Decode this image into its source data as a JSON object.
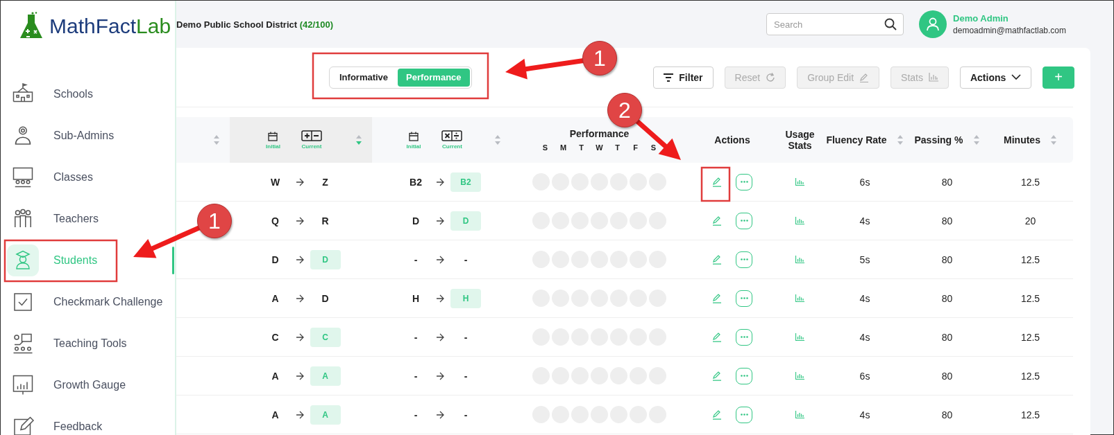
{
  "sidebar": {
    "logo": {
      "part1": "MathFact",
      "part2": "Lab"
    },
    "items": [
      {
        "label": "Schools",
        "selected": false
      },
      {
        "label": "Sub-Admins",
        "selected": false
      },
      {
        "label": "Classes",
        "selected": false
      },
      {
        "label": "Teachers",
        "selected": false
      },
      {
        "label": "Students",
        "selected": true
      },
      {
        "label": "Checkmark Challenge",
        "selected": false
      },
      {
        "label": "Teaching Tools",
        "selected": false
      },
      {
        "label": "Growth Gauge",
        "selected": false
      },
      {
        "label": "Feedback",
        "selected": false
      }
    ]
  },
  "header": {
    "district": "Demo Public School District",
    "quota": "(42/100)",
    "search": {
      "placeholder": "Search"
    },
    "user": {
      "name": "Demo Admin",
      "email": "demoadmin@mathfactlab.com"
    }
  },
  "view_toggle": [
    {
      "label": "Informative",
      "selected": false
    },
    {
      "label": "Performance",
      "selected": true
    }
  ],
  "toolbar": [
    {
      "label": "Filter",
      "kind": "filter",
      "disabled": false
    },
    {
      "label": "Reset",
      "kind": "reset",
      "disabled": true
    },
    {
      "label": "Group Edit",
      "kind": "edit",
      "disabled": true
    },
    {
      "label": "Stats",
      "kind": "stats",
      "disabled": true
    },
    {
      "label": "Actions",
      "kind": "dropdown",
      "disabled": false
    },
    {
      "label": "+",
      "kind": "add",
      "disabled": false
    }
  ],
  "table": {
    "columns": [
      {
        "kind": "name",
        "sorted": false
      },
      {
        "kind": "add_sub_levels",
        "initial_label": "Initial",
        "current_label": "Current",
        "sorted": true
      },
      {
        "kind": "mul_div_levels",
        "initial_label": "Initial",
        "current_label": "Current",
        "sorted": false
      },
      {
        "kind": "performance",
        "label": "Performance",
        "days": [
          "S",
          "M",
          "T",
          "W",
          "T",
          "F",
          "S"
        ]
      },
      {
        "kind": "text",
        "label": "Actions"
      },
      {
        "kind": "text",
        "label": "Usage Stats"
      },
      {
        "kind": "text",
        "label": "Fluency Rate",
        "sorted": false
      },
      {
        "kind": "text",
        "label": "Passing %",
        "sorted": false
      },
      {
        "kind": "text",
        "label": "Minutes",
        "sorted": false
      }
    ],
    "rows": [
      {
        "add": {
          "initial": "W",
          "current": "Z",
          "badge": false
        },
        "mul": {
          "initial": "B2",
          "current": "B2",
          "badge": true
        },
        "fluency": "6s",
        "passing": "80",
        "minutes": "12.5"
      },
      {
        "add": {
          "initial": "Q",
          "current": "R",
          "badge": false
        },
        "mul": {
          "initial": "D",
          "current": "D",
          "badge": true
        },
        "fluency": "4s",
        "passing": "80",
        "minutes": "20"
      },
      {
        "add": {
          "initial": "D",
          "current": "D",
          "badge": true
        },
        "mul": {
          "initial": "-",
          "current": "-",
          "badge": false
        },
        "fluency": "5s",
        "passing": "80",
        "minutes": "12.5"
      },
      {
        "add": {
          "initial": "A",
          "current": "D",
          "badge": false
        },
        "mul": {
          "initial": "H",
          "current": "H",
          "badge": true
        },
        "fluency": "4s",
        "passing": "80",
        "minutes": "12.5"
      },
      {
        "add": {
          "initial": "C",
          "current": "C",
          "badge": true
        },
        "mul": {
          "initial": "-",
          "current": "-",
          "badge": false
        },
        "fluency": "4s",
        "passing": "80",
        "minutes": "12.5"
      },
      {
        "add": {
          "initial": "A",
          "current": "A",
          "badge": true
        },
        "mul": {
          "initial": "-",
          "current": "-",
          "badge": false
        },
        "fluency": "6s",
        "passing": "80",
        "minutes": "12.5"
      },
      {
        "add": {
          "initial": "A",
          "current": "A",
          "badge": true
        },
        "mul": {
          "initial": "-",
          "current": "-",
          "badge": false
        },
        "fluency": "4s",
        "passing": "80",
        "minutes": "12.5"
      }
    ]
  },
  "callouts": [
    {
      "label": "1"
    },
    {
      "label": "2"
    },
    {
      "label": "1"
    }
  ]
}
